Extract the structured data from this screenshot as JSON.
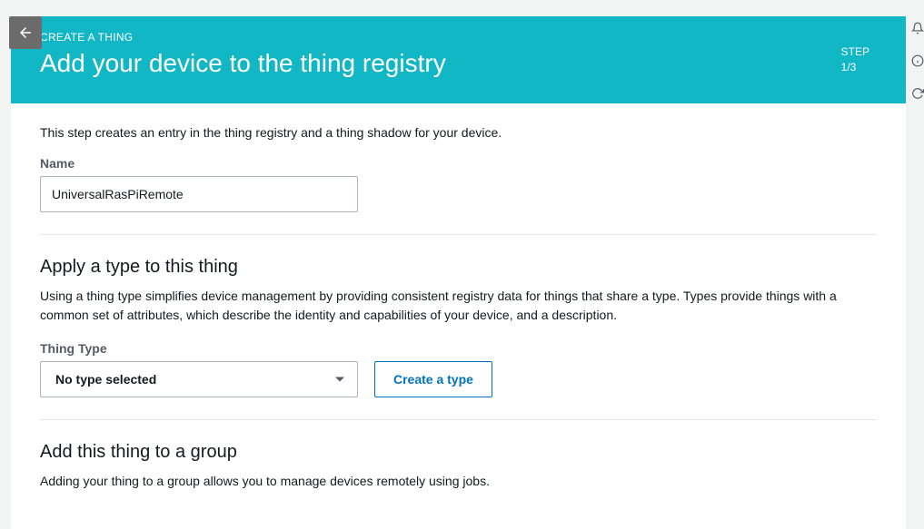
{
  "header": {
    "breadcrumb": "CREATE A THING",
    "title": "Add your device to the thing registry",
    "step_label": "STEP",
    "step_value": "1/3"
  },
  "section_name": {
    "intro": "This step creates an entry in the thing registry and a thing shadow for your device.",
    "name_label": "Name",
    "name_value": "UniversalRasPiRemote"
  },
  "section_type": {
    "heading": "Apply a type to this thing",
    "desc": "Using a thing type simplifies device management by providing consistent registry data for things that share a type. Types provide things with a common set of attributes, which describe the identity and capabilities of your device, and a description.",
    "type_label": "Thing Type",
    "selected": "No type selected",
    "create_btn": "Create a type"
  },
  "section_group": {
    "heading": "Add this thing to a group",
    "desc": "Adding your thing to a group allows you to manage devices remotely using jobs."
  }
}
